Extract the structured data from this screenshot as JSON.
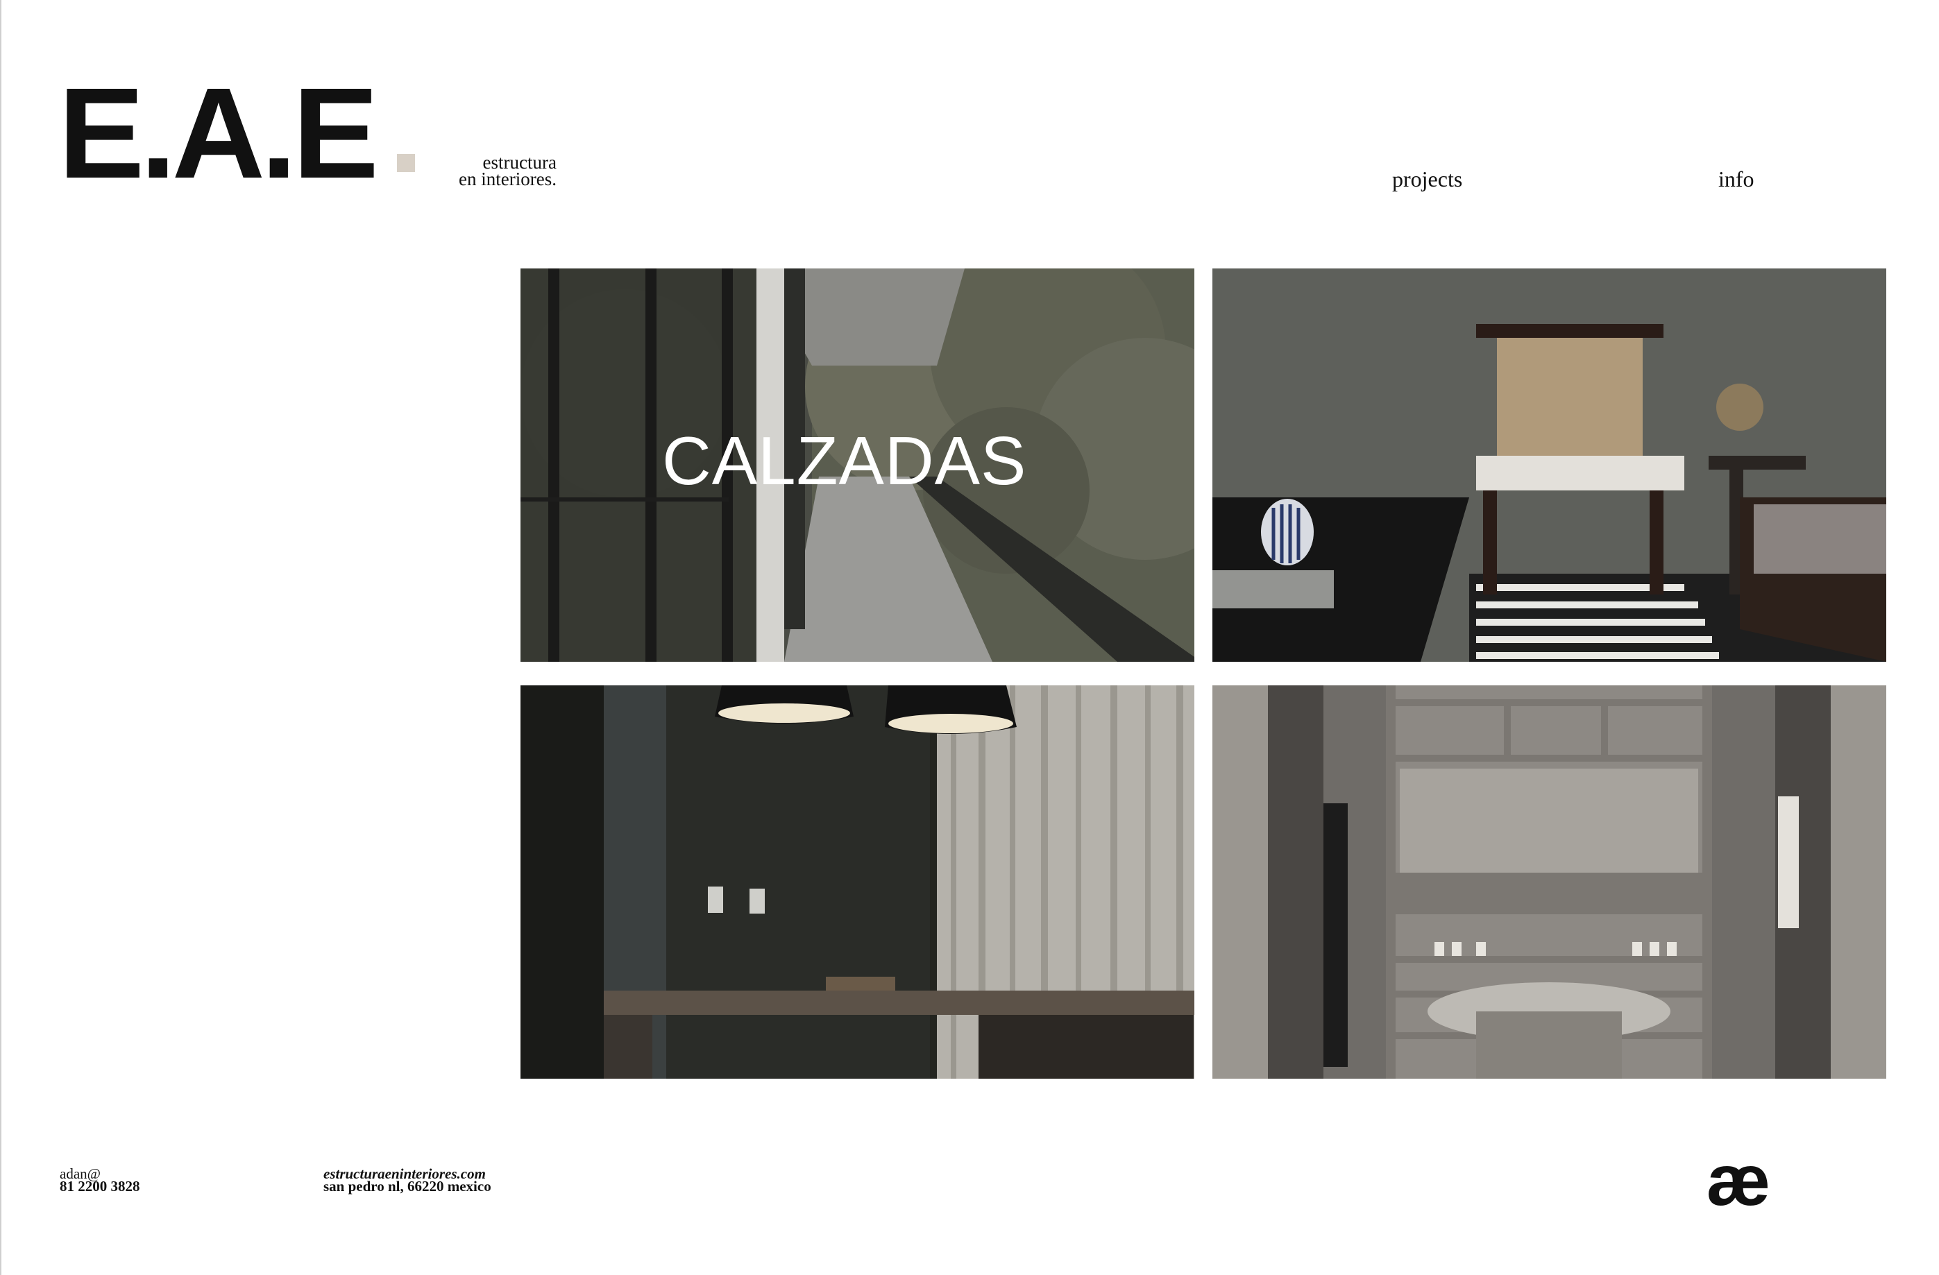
{
  "brand": {
    "logo": "E.A.E",
    "tagline_line1": "estructura",
    "tagline_line2": "en interiores.",
    "accent_color": "#d8d0c6"
  },
  "nav": {
    "projects": "projects",
    "info": "info"
  },
  "grid": {
    "featured_title": "CALZADAS",
    "tiles": [
      {
        "scene": "exterior-walkway-trees"
      },
      {
        "scene": "living-room-cane-chairs"
      },
      {
        "scene": "dining-table-pendant-lamps"
      },
      {
        "scene": "walk-in-closet-shelving"
      }
    ]
  },
  "footer": {
    "email": "adan@",
    "phone": "81 2200 3828",
    "website": "estructuraeninteriores.com",
    "address": "san pedro nl, 66220 mexico",
    "monogram": "æ"
  }
}
